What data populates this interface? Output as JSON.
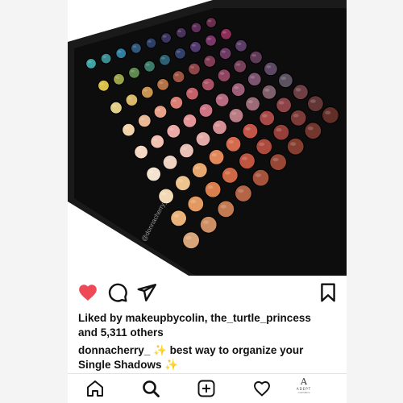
{
  "post": {
    "watermark": "@donnacherry_",
    "liked_by_prefix": "Liked by ",
    "liked_by_users": "makeupbycolin, the_turtle_princess",
    "liked_by_and": "and ",
    "liked_by_count": "5,311 others",
    "caption_user": "donnacherry_",
    "caption_sparkle_1": "✨",
    "caption_text_1": "best way to organize your",
    "caption_text_2": "Single Shadows",
    "caption_sparkle_2": "✨"
  },
  "actions": {
    "like_icon": "heart-filled-icon",
    "comment_icon": "comment-icon",
    "share_icon": "send-icon",
    "save_icon": "bookmark-icon",
    "like_color": "#ed4956"
  },
  "tabbar": {
    "items": [
      {
        "icon": "home-icon"
      },
      {
        "icon": "search-icon"
      },
      {
        "icon": "add-post-icon"
      },
      {
        "icon": "heart-outline-icon"
      },
      {
        "icon": "profile-brand-logo"
      }
    ],
    "brand_mark": "A",
    "brand_name": "ADEPT",
    "brand_sub": "cosmetics"
  },
  "palette": {
    "frame_color": "#1a1a1a",
    "swatch_colors": [
      [
        "#3fa3a4",
        "#3a8c8f",
        "#2f7fa0",
        "#31577a",
        "#2e3f66",
        "#3b3560",
        "#49325a",
        "#5d2f5a",
        "#6b2f4d"
      ],
      [
        "#d9c04a",
        "#9aa34a",
        "#5f8a4f",
        "#3c7a6a",
        "#2c5f70",
        "#33406b",
        "#523a6d",
        "#7b3767",
        "#8c2f58"
      ],
      [
        "#e2cf86",
        "#d9b86a",
        "#c79453",
        "#b57448",
        "#9e5442",
        "#8d4548",
        "#7f3c55",
        "#6c3a62",
        "#5a3e66"
      ],
      [
        "#f2d3a9",
        "#e8b894",
        "#e7a189",
        "#d97f73",
        "#c5616a",
        "#a85164",
        "#8f4560",
        "#77405b",
        "#5f3a56"
      ],
      [
        "#f6d8c2",
        "#f1c1b2",
        "#eaa9a6",
        "#e49598",
        "#cd7585",
        "#b66c80",
        "#9d5f78",
        "#7d5470",
        "#5e4965"
      ],
      [
        "#f3e4d2",
        "#eed2c2",
        "#e8bfb4",
        "#e3aba8",
        "#d38f93",
        "#b97b84",
        "#9b6b77",
        "#7f5f6c",
        "#5c5360"
      ],
      [
        "#f2d9b6",
        "#edc48e",
        "#e8a76e",
        "#e08859",
        "#d46b4f",
        "#c1554a",
        "#a84a48",
        "#8c4448",
        "#6e4045"
      ],
      [
        "#e9b27a",
        "#e39a62",
        "#d97f4d",
        "#cd6844",
        "#bf5440",
        "#ad4a3e",
        "#963f3a",
        "#7c3a38",
        "#633636"
      ],
      [
        "#d8a47a",
        "#cc8e62",
        "#c27a52",
        "#b46546",
        "#a6533d",
        "#964835",
        "#843e30",
        "#73362c",
        "#612f28"
      ]
    ]
  }
}
